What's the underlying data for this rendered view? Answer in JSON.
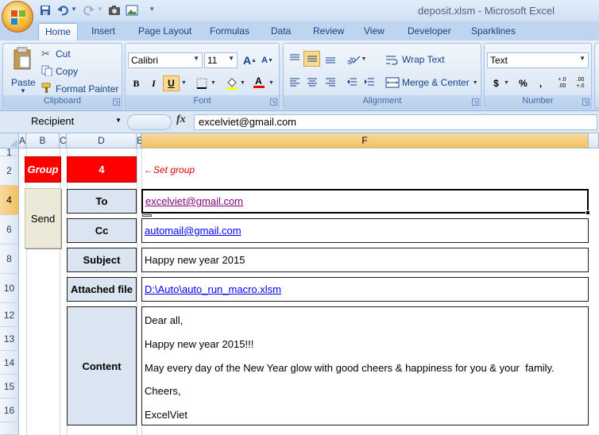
{
  "window": {
    "title": "deposit.xlsm - Microsoft Excel"
  },
  "tabs": [
    "Home",
    "Insert",
    "Page Layout",
    "Formulas",
    "Data",
    "Review",
    "View",
    "Developer",
    "Sparklines"
  ],
  "ribbon": {
    "clipboard": {
      "label": "Clipboard",
      "paste": "Paste",
      "cut": "Cut",
      "copy": "Copy",
      "format_painter": "Format Painter"
    },
    "font": {
      "label": "Font",
      "font_name": "Calibri",
      "font_size": "11",
      "bold": "B",
      "italic": "I",
      "underline": "U",
      "grow": "A",
      "shrink": "A",
      "font_color": "A"
    },
    "alignment": {
      "label": "Alignment",
      "wrap_text": "Wrap Text",
      "merge_center": "Merge & Center"
    },
    "number": {
      "label": "Number",
      "format": "Text",
      "currency": "$",
      "percent": "%",
      "comma": ",",
      "inc_decimal": "+.0 .00",
      "dec_decimal": ".00 +.0"
    }
  },
  "formula_bar": {
    "name_box": "Recipient",
    "fx": "fx",
    "value": "excelviet@gmail.com"
  },
  "columns": [
    "A",
    "B",
    "C",
    "D",
    "E",
    "F"
  ],
  "rows": [
    "1",
    "2",
    "4",
    "6",
    "8",
    "10",
    "12",
    "13",
    "14",
    "15",
    "16"
  ],
  "sheet": {
    "group_label": "Group",
    "group_value": "4",
    "set_group_note": "←Set group",
    "send_button": "Send",
    "to_label": "To",
    "to_value": "excelviet@gmail.com",
    "cc_label": "Cc",
    "cc_value": "automail@gmail.com",
    "subject_label": "Subject",
    "subject_value": "Happy new year 2015",
    "attach_label": "Attached file",
    "attach_value": "D:\\Auto\\auto_run_macro.xlsm",
    "content_label": "Content",
    "content_lines": [
      "Dear all,",
      "Happy new year 2015!!!",
      "May every day of the New Year glow with good cheers & happiness for you & your  family.",
      "Cheers,",
      "ExcelViet"
    ]
  },
  "colors": {
    "group_red": "#ff0000",
    "label_fill": "#dbe5f1",
    "selection_orange": "#f1c15f"
  }
}
